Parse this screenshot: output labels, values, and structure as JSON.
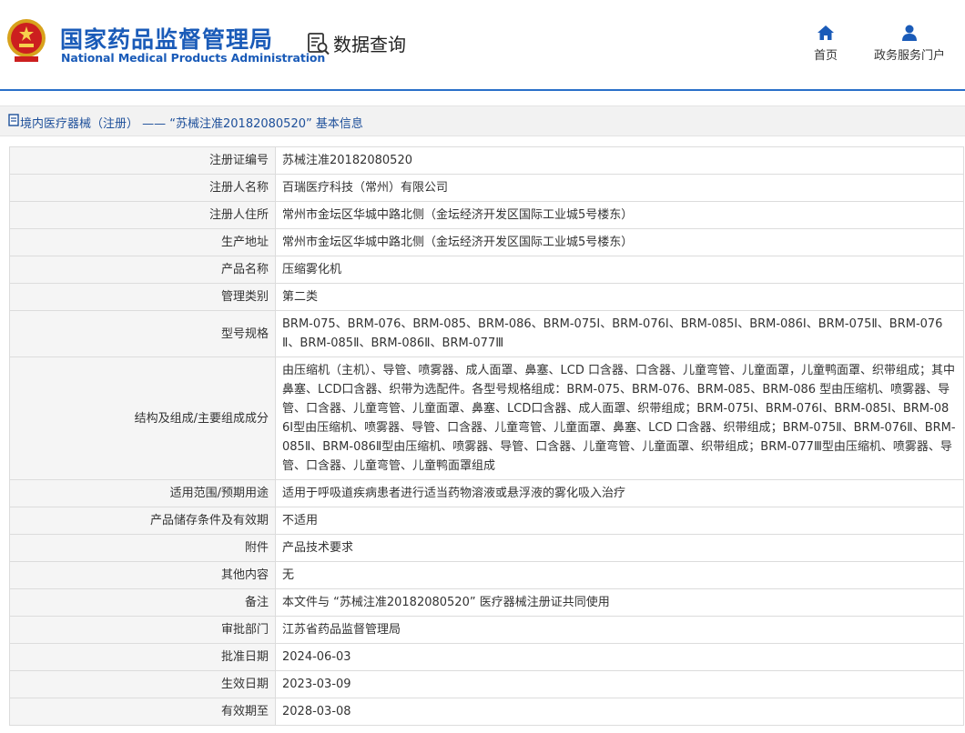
{
  "header": {
    "title_cn": "国家药品监督管理局",
    "title_en": "National Medical Products Administration",
    "query_label": "数据查询",
    "nav": {
      "home": "首页",
      "gov_service": "政务服务门户"
    },
    "accent_color": "#1a5bb8"
  },
  "breadcrumb": {
    "text": "境内医疗器械（注册） —— “苏械注准20182080520” 基本信息"
  },
  "rows": [
    {
      "label": "注册证编号",
      "value": "苏械注准20182080520"
    },
    {
      "label": "注册人名称",
      "value": "百瑞医疗科技（常州）有限公司"
    },
    {
      "label": "注册人住所",
      "value": "常州市金坛区华城中路北侧（金坛经济开发区国际工业城5号楼东）"
    },
    {
      "label": "生产地址",
      "value": "常州市金坛区华城中路北侧（金坛经济开发区国际工业城5号楼东）"
    },
    {
      "label": "产品名称",
      "value": "压缩雾化机"
    },
    {
      "label": "管理类别",
      "value": "第二类"
    },
    {
      "label": "型号规格",
      "value": "BRM-075、BRM-076、BRM-085、BRM-086、BRM-075Ⅰ、BRM-076Ⅰ、BRM-085Ⅰ、BRM-086Ⅰ、BRM-075Ⅱ、BRM-076Ⅱ、BRM-085Ⅱ、BRM-086Ⅱ、BRM-077Ⅲ"
    },
    {
      "label": "结构及组成/主要组成成分",
      "value": "由压缩机（主机）、导管、喷雾器、成人面罩、鼻塞、LCD 口含器、口含器、儿童弯管、儿童面罩，儿童鸭面罩、织带组成；其中鼻塞、LCD口含器、织带为选配件。各型号规格组成：BRM-075、BRM-076、BRM-085、BRM-086 型由压缩机、喷雾器、导管、口含器、儿童弯管、儿童面罩、鼻塞、LCD口含器、成人面罩、织带组成；BRM-075Ⅰ、BRM-076Ⅰ、BRM-085Ⅰ、BRM-086Ⅰ型由压缩机、喷雾器、导管、口含器、儿童弯管、儿童面罩、鼻塞、LCD 口含器、织带组成；BRM-075Ⅱ、BRM-076Ⅱ、BRM-085Ⅱ、BRM-086Ⅱ型由压缩机、喷雾器、导管、口含器、儿童弯管、儿童面罩、织带组成；BRM-077Ⅲ型由压缩机、喷雾器、导管、口含器、儿童弯管、儿童鸭面罩组成"
    },
    {
      "label": "适用范围/预期用途",
      "value": "适用于呼吸道疾病患者进行适当药物溶液或悬浮液的雾化吸入治疗"
    },
    {
      "label": "产品储存条件及有效期",
      "value": "不适用"
    },
    {
      "label": "附件",
      "value": "产品技术要求"
    },
    {
      "label": "其他内容",
      "value": "无"
    },
    {
      "label": "备注",
      "value": "本文件与 “苏械注准20182080520” 医疗器械注册证共同使用"
    },
    {
      "label": "审批部门",
      "value": "江苏省药品监督管理局"
    },
    {
      "label": "批准日期",
      "value": "2024-06-03"
    },
    {
      "label": "生效日期",
      "value": "2023-03-09"
    },
    {
      "label": "有效期至",
      "value": "2028-03-08"
    }
  ]
}
